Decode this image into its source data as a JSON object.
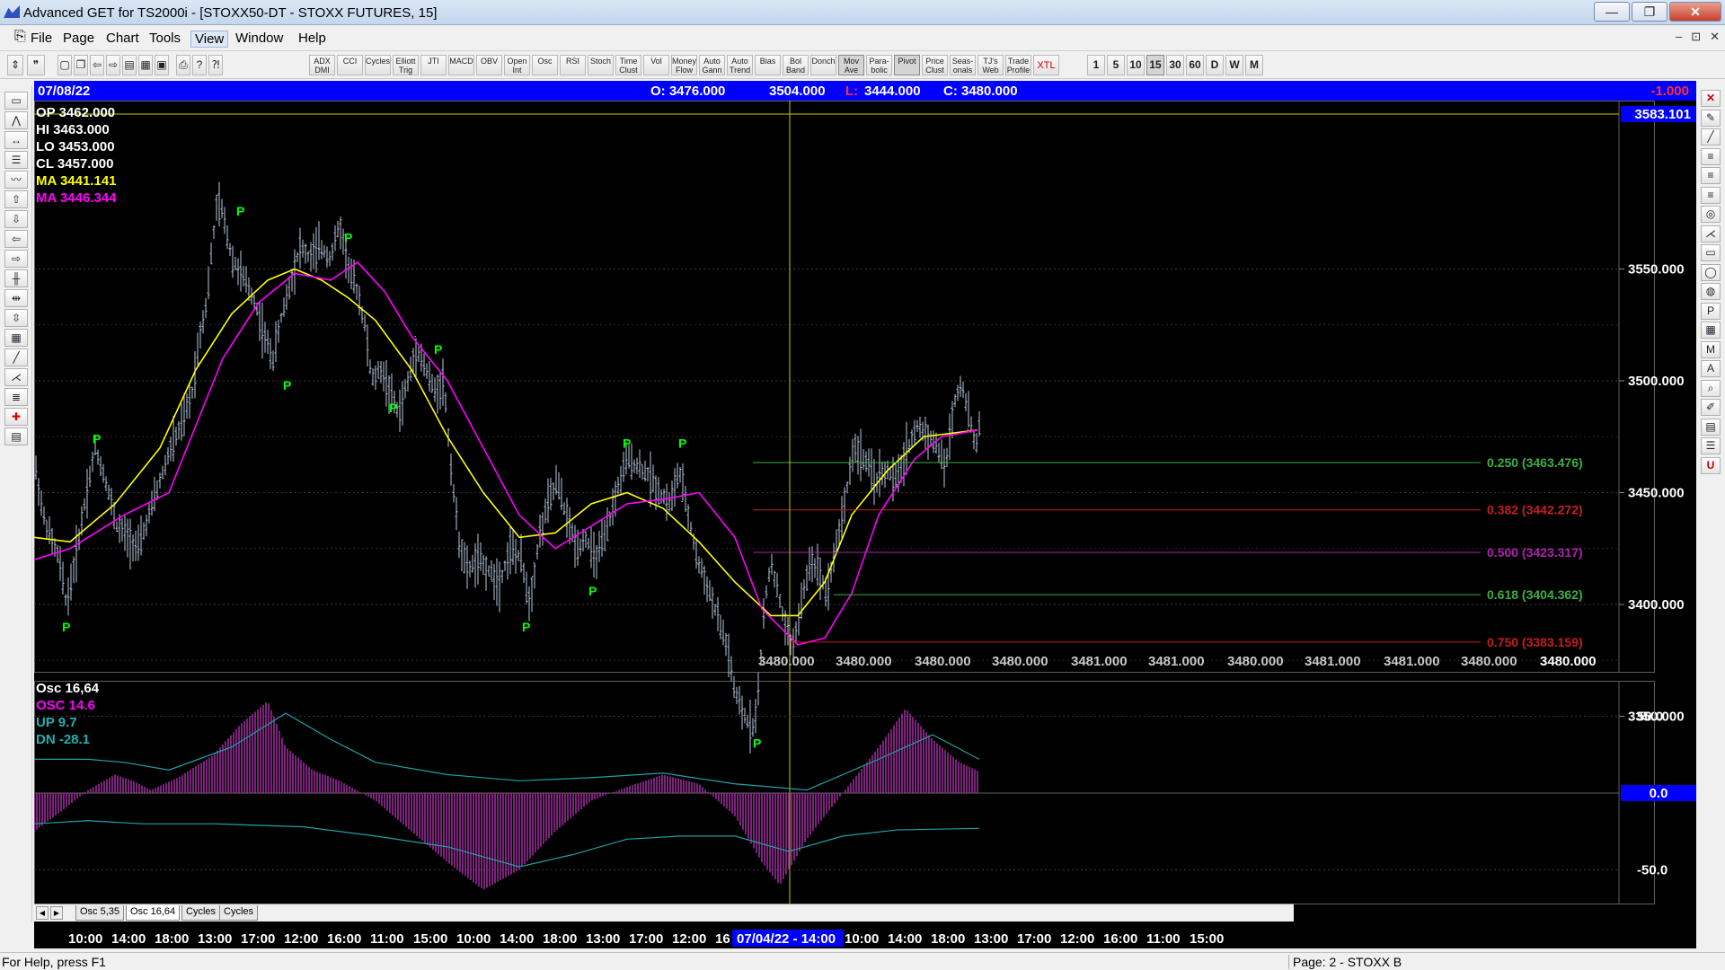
{
  "window": {
    "title": "Advanced GET for TS2000i - [STOXX50-DT - STOXX FUTURES, 15]",
    "min": "—",
    "max": "❐",
    "close": "✕"
  },
  "menu": [
    "File",
    "Page",
    "Chart",
    "Tools",
    "View",
    "Window",
    "Help"
  ],
  "mdi": [
    "–",
    "⊡",
    "✕"
  ],
  "toolbar": {
    "indicators": [
      "ADX DMI",
      "CCI",
      "Cycles",
      "Elliott Trig",
      "JTI",
      "MACD",
      "OBV",
      "Open Int",
      "Osc",
      "RSI",
      "Stoch",
      "Time Clust",
      "Vol",
      "Money Flow",
      "Auto Gann",
      "Auto Trend",
      "Bias",
      "Bol Band",
      "Donch",
      "Mov Ave",
      "Para- bolic",
      "Pivot",
      "Price Clust",
      "Seas- onals",
      "TJ's Web",
      "Trade Profile",
      "XTL"
    ],
    "periods": [
      "1",
      "5",
      "10",
      "15",
      "30",
      "60",
      "D",
      "W",
      "M"
    ]
  },
  "info_bar": {
    "date": "07/08/22",
    "open": "O: 3476.000",
    "high": "3504.000",
    "low_label": "L:",
    "low": "3444.000",
    "close": "C: 3480.000",
    "change": "-1.000"
  },
  "price_legend": {
    "op": "OP  3462.000",
    "hi": "HI   3463.000",
    "lo": "LO   3453.000",
    "cl": "CL   3457.000",
    "ma1": "MA  3441.141",
    "ma2": "MA  3446.344"
  },
  "price_axis": {
    "current": "3583.101",
    "ticks": [
      "3550.000",
      "3500.000",
      "3450.000",
      "3400.000",
      "3350.000"
    ]
  },
  "fib_levels": [
    {
      "label": "0.250 (3463.476)",
      "color": "#3cb043"
    },
    {
      "label": "0.382 (3442.272)",
      "color": "#c81e1e"
    },
    {
      "label": "0.500 (3423.317)",
      "color": "#b020b0"
    },
    {
      "label": "0.618 (3404.362)",
      "color": "#3cb043"
    },
    {
      "label": "0.750 (3383.159)",
      "color": "#c81e1e"
    }
  ],
  "pivot_label": "P",
  "bottom_prices": [
    "3480.000",
    "3480.000",
    "3480.000",
    "3480.000",
    "3481.000",
    "3481.000",
    "3480.000",
    "3481.000",
    "3481.000",
    "3480.000"
  ],
  "bottom_price_current": "3480.000",
  "osc_legend": {
    "title": "Osc 16,64",
    "osc": "OSC 14.6",
    "up": "UP    9.7",
    "dn": "DN   -28.1"
  },
  "osc_axis": {
    "ticks": [
      "50.0",
      "0.0",
      "-50.0"
    ]
  },
  "tabs": [
    "Osc 5,35",
    "Osc 16,64",
    "Cycles",
    "Cycles"
  ],
  "tabnav": [
    "◀",
    "▶"
  ],
  "time_axis": {
    "labels": [
      "10:00",
      "14:00",
      "18:00",
      "13:00",
      "17:00",
      "12:00",
      "16:00",
      "11:00",
      "15:00",
      "10:00",
      "14:00",
      "18:00",
      "13:00",
      "17:00",
      "12:00",
      "16"
    ],
    "cursor": "07/04/22 - 14:00",
    "labels2": [
      "10:00",
      "14:00",
      "18:00",
      "13:00",
      "17:00",
      "12:00",
      "16:00",
      "11:00",
      "15:00"
    ]
  },
  "status": {
    "left": "For Help, press F1",
    "right": "Page: 2 - STOXX B"
  },
  "colors": {
    "ma_yellow": "#ffff00",
    "ma_magenta": "#ff00ff",
    "bars": "#b8c8e0",
    "info_bar": "#0000ff",
    "pivot": "#00ff00",
    "osc_hist": "#b030b0"
  }
}
